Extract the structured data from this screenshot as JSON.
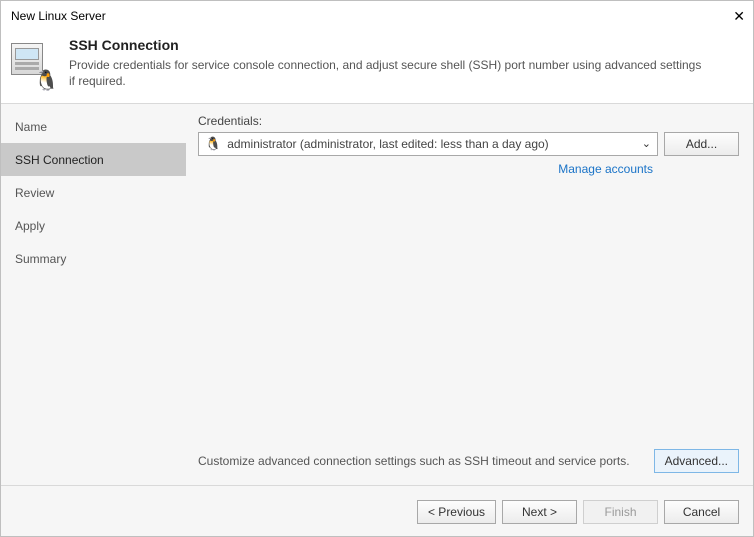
{
  "titlebar": {
    "title": "New Linux Server"
  },
  "header": {
    "title": "SSH Connection",
    "description": "Provide credentials for service console connection, and adjust secure shell (SSH) port number using advanced settings if required."
  },
  "sidebar": {
    "items": [
      {
        "label": "Name"
      },
      {
        "label": "SSH Connection"
      },
      {
        "label": "Review"
      },
      {
        "label": "Apply"
      },
      {
        "label": "Summary"
      }
    ],
    "selected_index": 1
  },
  "main": {
    "credentials_label": "Credentials:",
    "selected_credential": "administrator (administrator, last edited: less than a day ago)",
    "add_button": "Add...",
    "manage_accounts": "Manage accounts",
    "advanced_hint": "Customize advanced connection settings such as SSH timeout and service ports.",
    "advanced_button": "Advanced..."
  },
  "footer": {
    "previous": "< Previous",
    "next": "Next >",
    "finish": "Finish",
    "cancel": "Cancel"
  }
}
